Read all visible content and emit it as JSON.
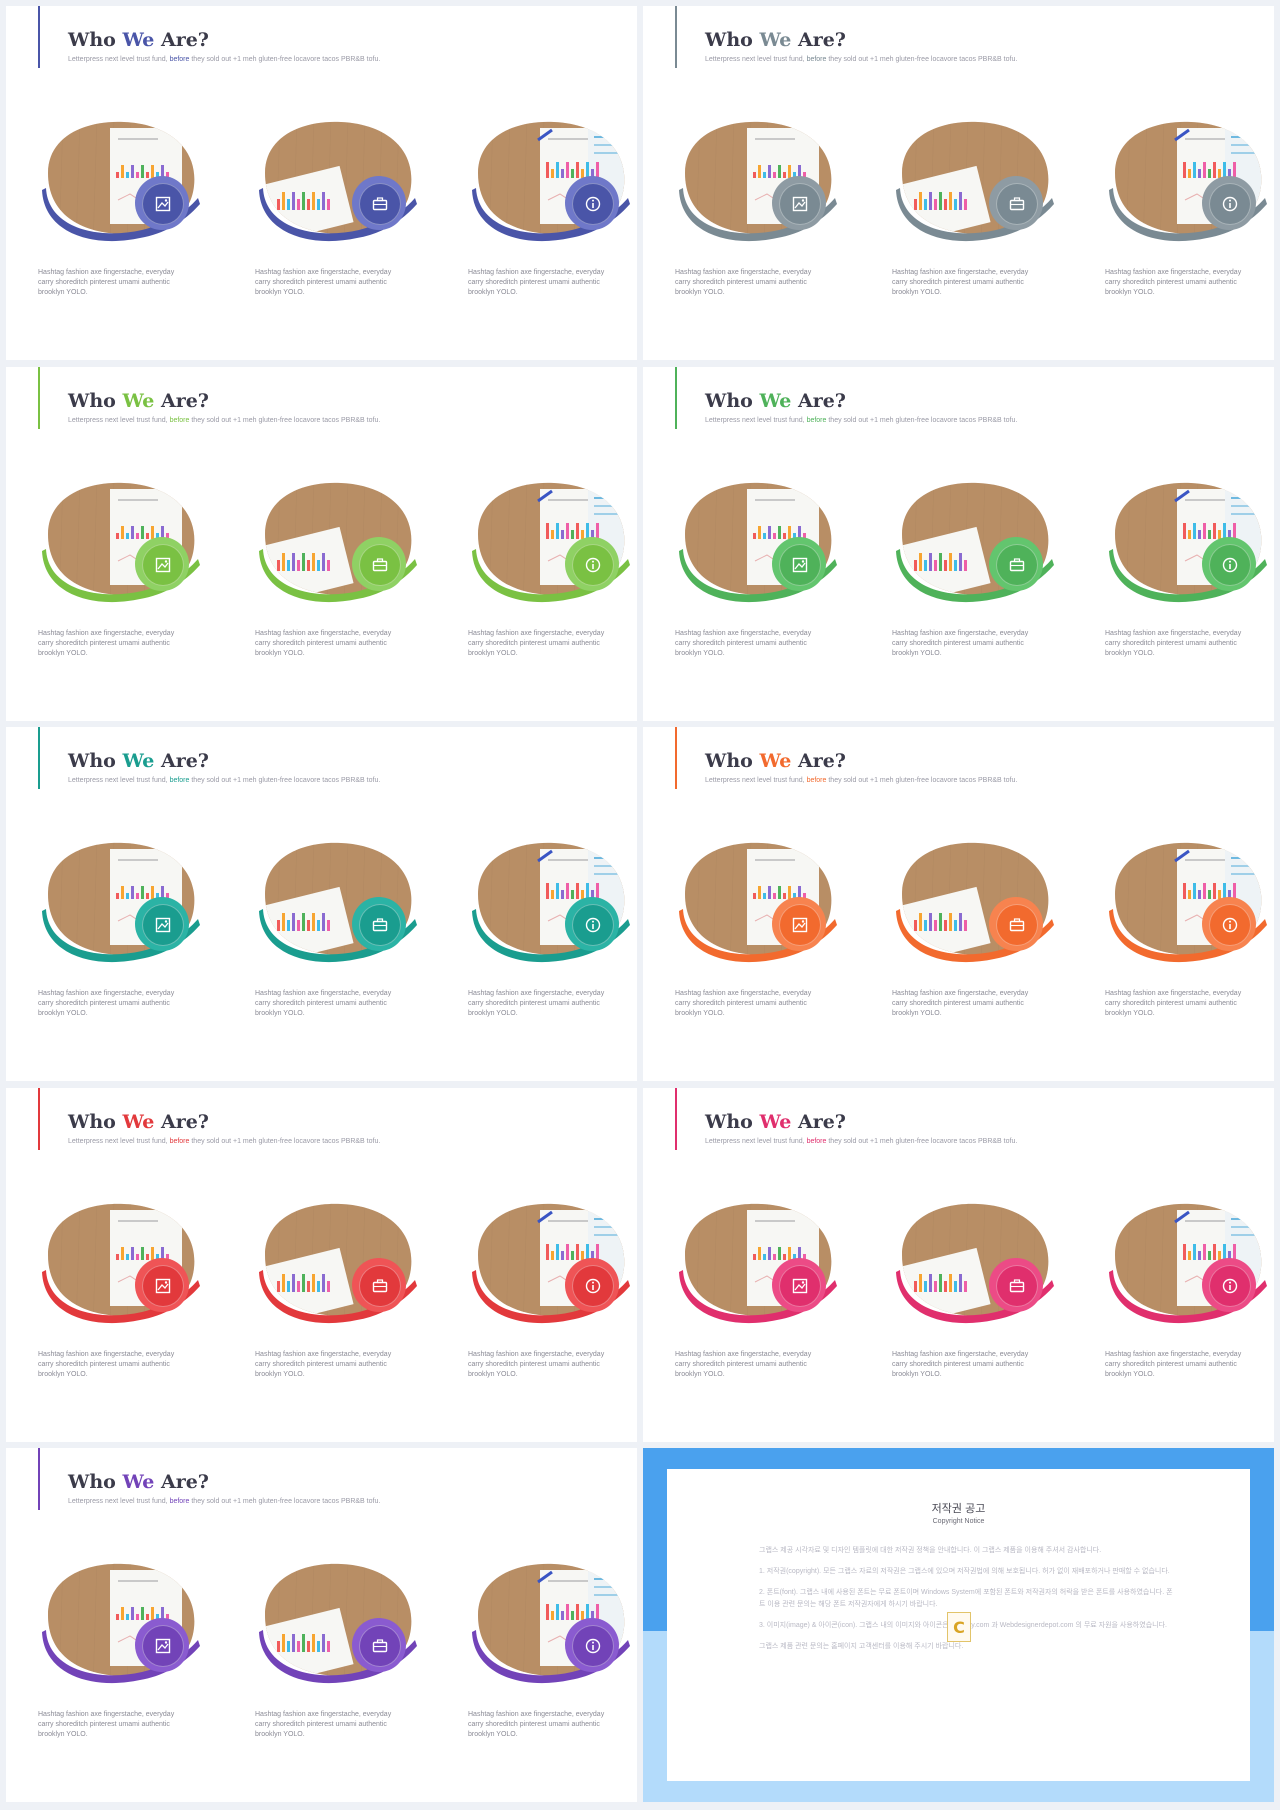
{
  "slides": [
    {
      "id": "s1",
      "accent": "#4a55a8",
      "icon_bg": "#6f78c9",
      "title_pre": "Who ",
      "title_hl": "We",
      "title_post": " Are?",
      "subtitle_pre": "Letterpress next level trust fund, before they sold out +1 meh gluten-free locavore tacos PBR&B tofu."
    },
    {
      "id": "s2",
      "accent": "#7a8a93",
      "icon_bg": "#8e9ba3",
      "title_pre": "Who ",
      "title_hl": "We",
      "title_post": " Are?",
      "subtitle_pre": "Letterpress next level trust fund, before they sold out +1 meh gluten-free locavore tacos PBR&B tofu."
    },
    {
      "id": "s3",
      "accent": "#7ac143",
      "icon_bg": "#8fd164",
      "title_pre": "Who ",
      "title_hl": "We",
      "title_post": " Are?",
      "subtitle_pre": "Letterpress next level trust fund, before they sold out +1 meh gluten-free locavore tacos PBR&B tofu."
    },
    {
      "id": "s4",
      "accent": "#4fb25a",
      "icon_bg": "#63c56e",
      "title_pre": "Who ",
      "title_hl": "We",
      "title_post": " Are?",
      "subtitle_pre": "Letterpress next level trust fund, before they sold out +1 meh gluten-free locavore tacos PBR&B tofu."
    },
    {
      "id": "s5",
      "accent": "#1a9d8f",
      "icon_bg": "#2bb3a5",
      "title_pre": "Who ",
      "title_hl": "We",
      "title_post": " Are?",
      "subtitle_pre": "Letterpress next level trust fund, before they sold out +1 meh gluten-free locavore tacos PBR&B tofu."
    },
    {
      "id": "s6",
      "accent": "#f26a2e",
      "icon_bg": "#f7834f",
      "title_pre": "Who ",
      "title_hl": "We",
      "title_post": " Are?",
      "subtitle_pre": "Letterpress next level trust fund, before they sold out +1 meh gluten-free locavore tacos PBR&B tofu."
    },
    {
      "id": "s7",
      "accent": "#e2393c",
      "icon_bg": "#ef5456",
      "title_pre": "Who ",
      "title_hl": "We",
      "title_post": " Are?",
      "subtitle_pre": "Letterpress next level trust fund, before they sold out +1 meh gluten-free locavore tacos PBR&B tofu."
    },
    {
      "id": "s8",
      "accent": "#e02f6d",
      "icon_bg": "#ec4b86",
      "title_pre": "Who ",
      "title_hl": "We",
      "title_post": " Are?",
      "subtitle_pre": "Letterpress next level trust fund, before they sold out +1 meh gluten-free locavore tacos PBR&B tofu."
    },
    {
      "id": "s9",
      "accent": "#7243b8",
      "icon_bg": "#8a5bd0",
      "title_pre": "Who ",
      "title_hl": "We",
      "title_post": " Are?",
      "subtitle_pre": "Letterpress next level trust fund, before they sold out +1 meh gluten-free locavore tacos PBR&B tofu."
    }
  ],
  "cards": [
    {
      "icon": "image-icon",
      "text": "Hashtag fashion axe fingerstache, everyday carry shoreditch pinterest umami authentic brooklyn YOLO."
    },
    {
      "icon": "briefcase-icon",
      "text": "Hashtag fashion axe fingerstache, everyday carry shoreditch pinterest umami authentic brooklyn YOLO."
    },
    {
      "icon": "info-icon",
      "text": "Hashtag fashion axe fingerstache, everyday carry shoreditch pinterest umami authentic brooklyn YOLO."
    }
  ],
  "copyright": {
    "title": "저작권 공고",
    "subtitle": "Copyright Notice",
    "logo_letter": "C",
    "paragraphs": [
      "그랩스 제공 시각자료 및 디자인 템플릿에 대한 저작권 정책을 안내합니다. 이 그랩스 제품을 이용해 주셔서 감사합니다.",
      "1. 저작권(copyright). 모든 그랩스 자료의 저작권은 그랩스에 있으며 저작권법에 의해 보호됩니다. 허가 없이 재배포하거나 판매할 수 없습니다.",
      "2. 폰트(font). 그랩스 내에 사용된 폰트는 무료 폰트이며 Windows System에 포함된 폰트와 저작권자의 허락을 받은 폰트를 사용하였습니다. 폰트 이용 관련 문의는 해당 폰트 저작권자에게 하시기 바랍니다.",
      "3. 이미지(image) & 아이콘(icon). 그랩스 내의 이미지와 아이콘은 pixabay.com 과 Webdesignerdepot.com 의 무료 자원을 사용하였습니다.",
      "그랩스 제품 관련 문의는 홈페이지 고객센터를 이용해 주시기 바랍니다."
    ]
  }
}
